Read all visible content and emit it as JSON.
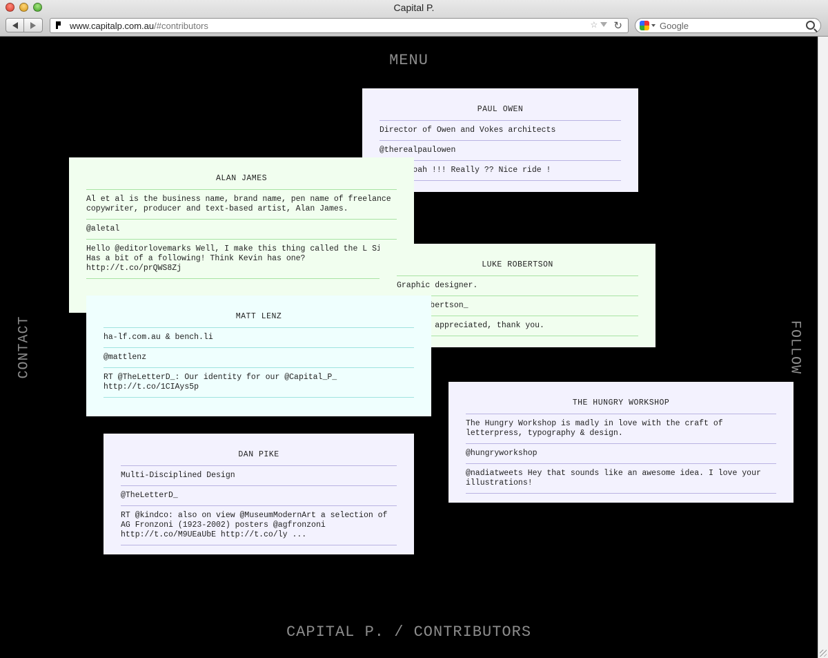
{
  "window": {
    "title": "Capital P."
  },
  "browser": {
    "url_host": "www.capitalp.com.au",
    "url_path": "/#contributors",
    "search_placeholder": "Google"
  },
  "page": {
    "menu": "MENU",
    "contact": "CONTACT",
    "follow": "FOLLOW",
    "footer": "CAPITAL P. / CONTRIBUTORS"
  },
  "contributors": [
    {
      "name": "PAUL OWEN",
      "bio": "Director of Owen and Vokes architects",
      "handle": "@therealpaulowen",
      "tweet": "@hans woah !!! Really ?? Nice ride !",
      "color": "#f3f2fe"
    },
    {
      "name": "ALAN JAMES",
      "bio": "Al et al is the business name, brand name, pen name of freelance copywriter, producer and text-based artist, Alan James.",
      "handle": "@aletal",
      "tweet": "Hello @editorlovemarks Well, I make this thing called the L Sign. Has a bit of a following! Think Kevin has one? http://t.co/prQWS8Zj",
      "color": "#f1feef"
    },
    {
      "name": "LUKE ROBERTSON",
      "bio": "Graphic designer.",
      "handle": "@lukerobertson_",
      "tweet": "@L Much appreciated, thank you.",
      "color": "#f1feef"
    },
    {
      "name": "MATT LENZ",
      "bio": "ha-lf.com.au & bench.li",
      "handle": "@mattlenz",
      "tweet": "RT @TheLetterD_: Our identity for our @Capital_P_ http://t.co/1CIAys5p",
      "color": "#effffe"
    },
    {
      "name": "THE HUNGRY WORKSHOP",
      "bio": "The Hungry Workshop is madly in love with the craft of letterpress, typography & design.",
      "handle": "@hungryworkshop",
      "tweet": "@nadiatweets Hey that sounds like an awesome idea. I love your illustrations!",
      "color": "#f3f2fe"
    },
    {
      "name": "DAN PIKE",
      "bio": "Multi-Disciplined Design",
      "handle": "@TheLetterD_",
      "tweet": "RT @kindco: also on view @MuseumModernArt a selection of AG Fronzoni (1923-2002) posters @agfronzoni http://t.co/M9UEaUbE http://t.co/ly ...",
      "color": "#f3f2fe"
    }
  ]
}
